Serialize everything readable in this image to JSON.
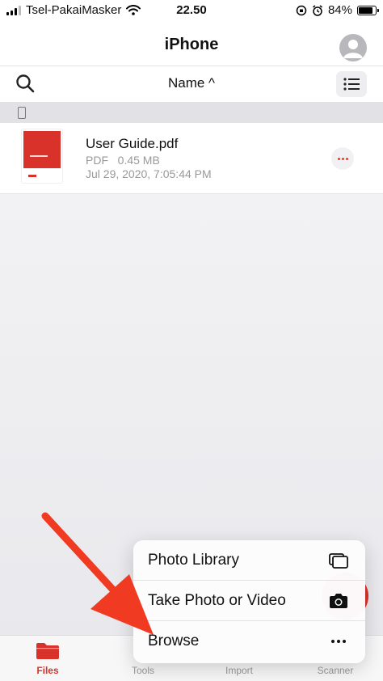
{
  "status_bar": {
    "carrier": "Tsel-PakaiMasker",
    "time": "22.50",
    "battery": "84%",
    "battery_level": 0.84
  },
  "nav": {
    "title": "iPhone",
    "avatar_icon": "person-icon"
  },
  "toolbar": {
    "search_icon": "search-icon",
    "sort_label": "Name ^",
    "view_icon": "list-icon"
  },
  "section": {
    "icon": "phone-icon"
  },
  "files": [
    {
      "name": "User Guide.pdf",
      "meta": "PDF   0.45 MB",
      "date": "Jul 29, 2020, 7:05:44 PM",
      "more_icon": "ellipsis-icon",
      "accent": "#d9322b"
    }
  ],
  "popup_menu": {
    "items": [
      {
        "label": "Photo Library",
        "icon": "photo-library-icon"
      },
      {
        "label": "Take Photo or Video",
        "icon": "camera-icon"
      },
      {
        "label": "Browse",
        "icon": "ellipsis-icon"
      }
    ]
  },
  "tabs": [
    {
      "label": "Files",
      "icon": "folder-icon",
      "active": true
    },
    {
      "label": "Tools",
      "icon": "tools-icon",
      "active": false
    },
    {
      "label": "Import",
      "icon": "import-icon",
      "active": false
    },
    {
      "label": "Scanner",
      "icon": "scanner-icon",
      "active": false
    }
  ],
  "colors": {
    "accent": "#d9322b",
    "annotation_arrow": "#f03a22"
  }
}
